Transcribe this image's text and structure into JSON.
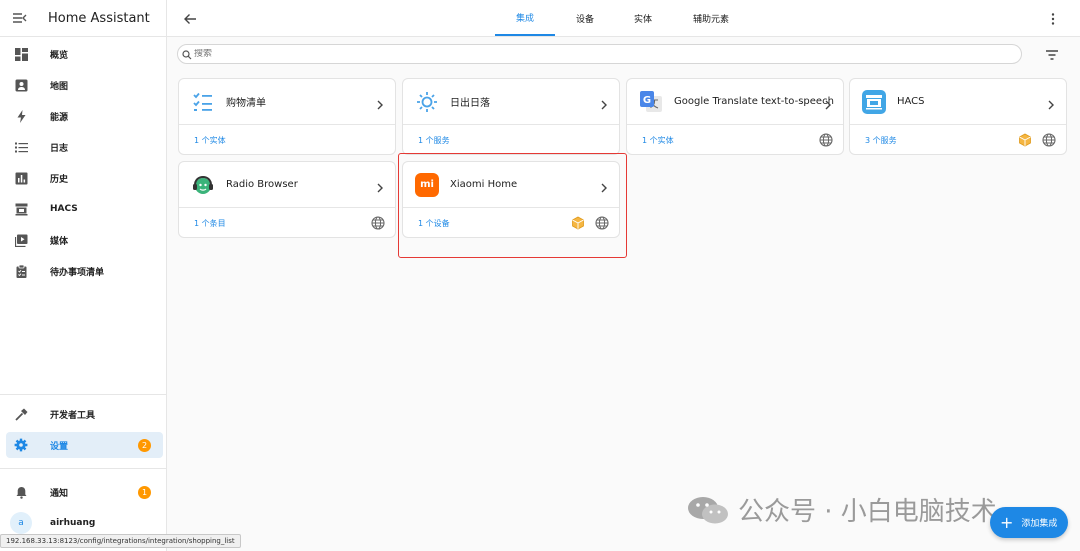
{
  "app": {
    "title": "Home Assistant"
  },
  "sidebar": {
    "items": [
      {
        "label": "概览",
        "icon": "dashboard-icon"
      },
      {
        "label": "地图",
        "icon": "map-icon"
      },
      {
        "label": "能源",
        "icon": "lightning-icon"
      },
      {
        "label": "日志",
        "icon": "logbook-icon"
      },
      {
        "label": "历史",
        "icon": "history-chart-icon"
      },
      {
        "label": "HACS",
        "icon": "hacs-icon"
      },
      {
        "label": "媒体",
        "icon": "media-icon"
      },
      {
        "label": "待办事项清单",
        "icon": "clipboard-icon"
      }
    ],
    "dev_tools": "开发者工具",
    "settings": {
      "label": "设置",
      "badge": "2"
    },
    "notifications": {
      "label": "通知",
      "badge": "1"
    },
    "user": {
      "initial": "a",
      "name": "airhuang"
    }
  },
  "tabs": [
    "集成",
    "设备",
    "实体",
    "辅助元素"
  ],
  "active_tab": "集成",
  "search": {
    "placeholder": "搜索"
  },
  "integrations": [
    {
      "name": "购物清单",
      "link": "1 个实体",
      "cloud": false,
      "custom": false
    },
    {
      "name": "日出日落",
      "link": "1 个服务",
      "cloud": false,
      "custom": false
    },
    {
      "name": "Google Translate text-to-speech",
      "link": "1 个实体",
      "cloud": true,
      "custom": false
    },
    {
      "name": "HACS",
      "link": "3 个服务",
      "cloud": true,
      "custom": true
    },
    {
      "name": "Radio Browser",
      "link": "1 个条目",
      "cloud": true,
      "custom": false
    },
    {
      "name": "Xiaomi Home",
      "link": "1 个设备",
      "cloud": true,
      "custom": true,
      "logo_text": "mi"
    }
  ],
  "fab": {
    "label": "添加集成"
  },
  "status_url": "192.168.33.13:8123/config/integrations/integration/shopping_list",
  "watermark": {
    "text": "公众号 · 小白电脑技术"
  },
  "colors": {
    "accent": "#1e88e5",
    "badge": "#ff9800",
    "highlight": "#e53935",
    "xiaomi": "#ff6900"
  }
}
